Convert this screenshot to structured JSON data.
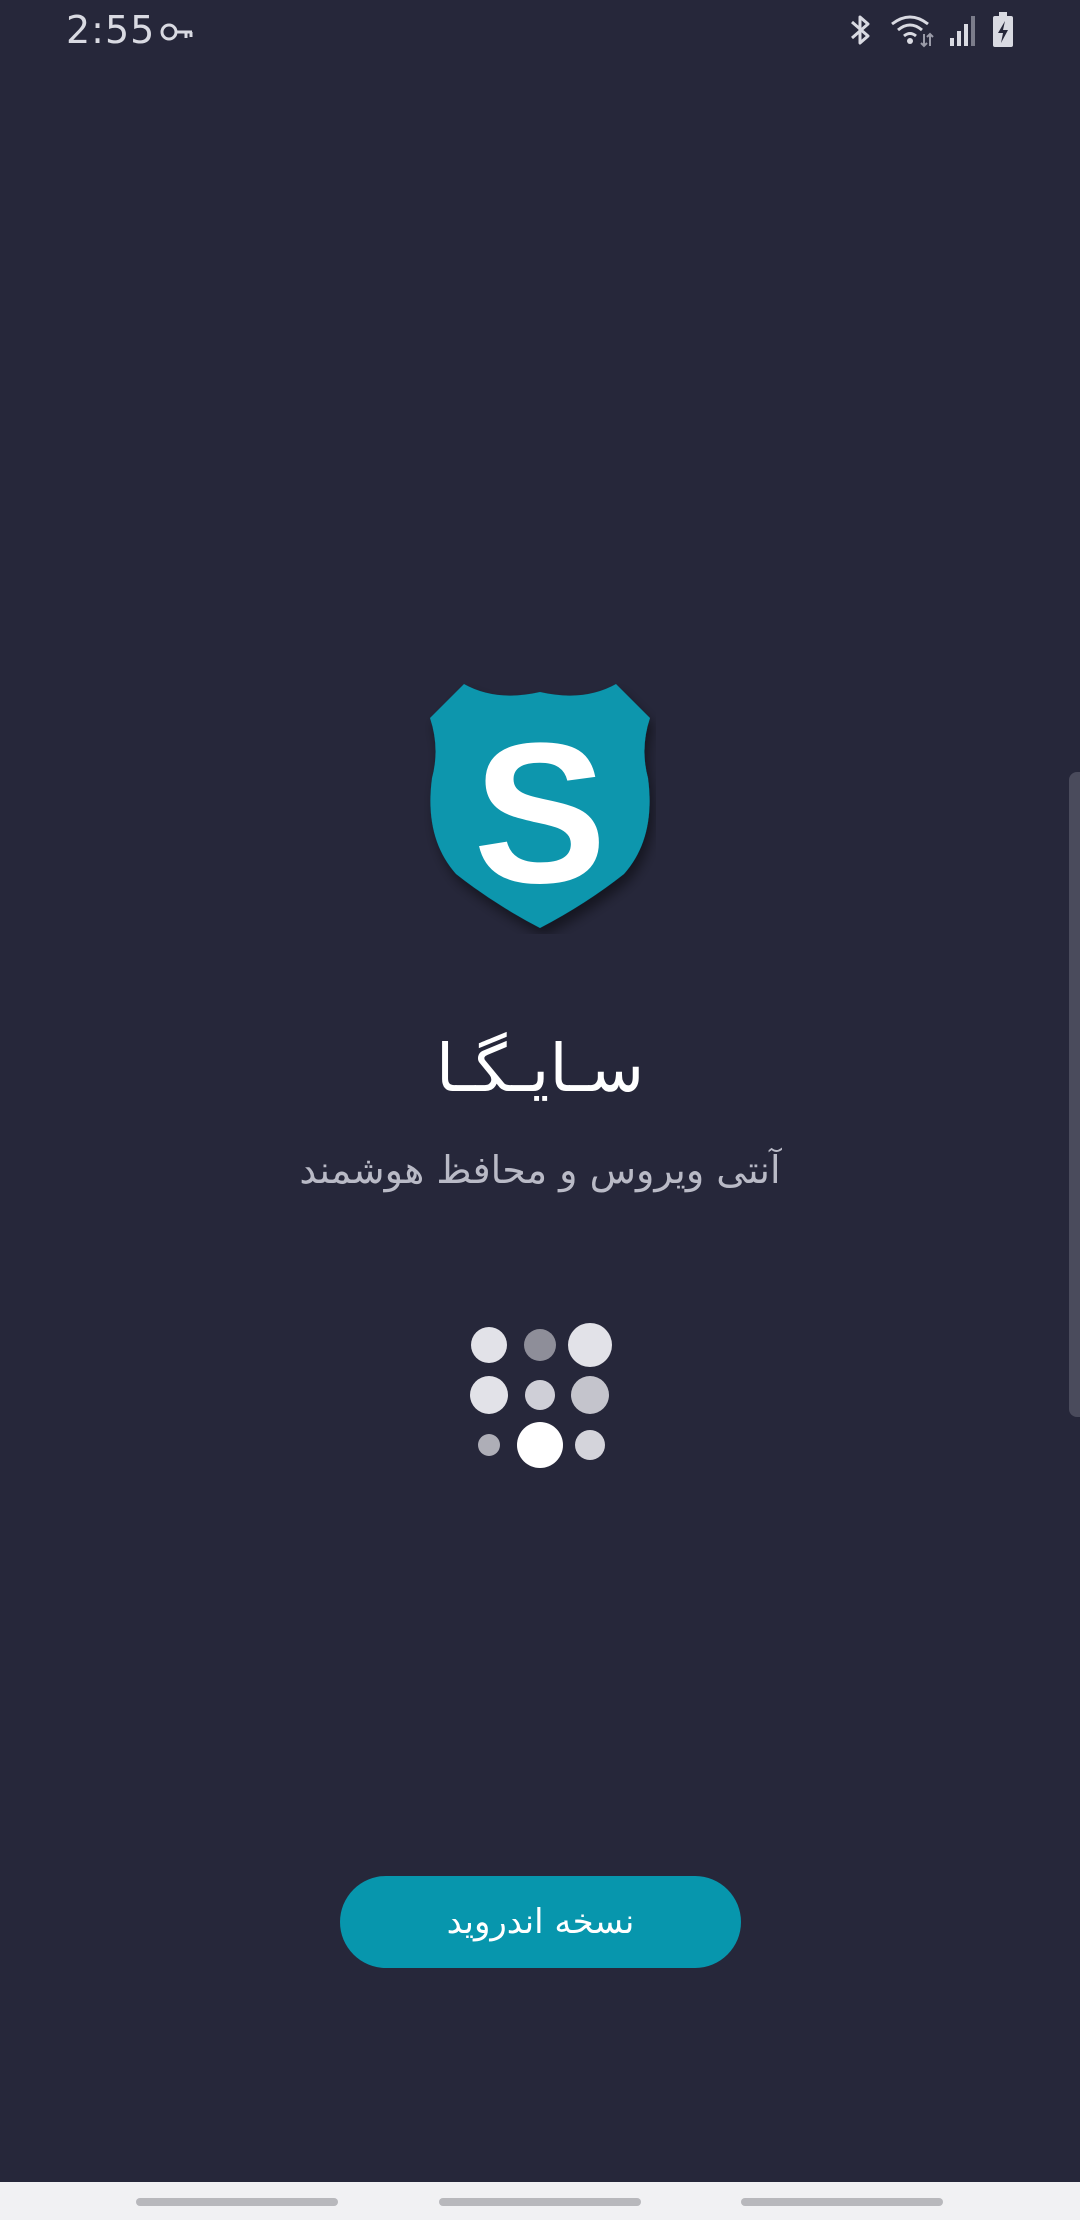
{
  "status_bar": {
    "time": "2:55",
    "icons": [
      "vpn-key-icon",
      "bluetooth-icon",
      "wifi-icon",
      "signal-icon",
      "battery-charging-icon"
    ]
  },
  "app": {
    "title": "سـایـگـا",
    "subtitle": "آنتی ویروس و محافظ هوشمند",
    "logo_letter": "S"
  },
  "actions": {
    "android_version_label": "نسخه اندروید"
  },
  "colors": {
    "background": "#26273a",
    "accent": "#0796ad",
    "shield": "#0796ad"
  }
}
